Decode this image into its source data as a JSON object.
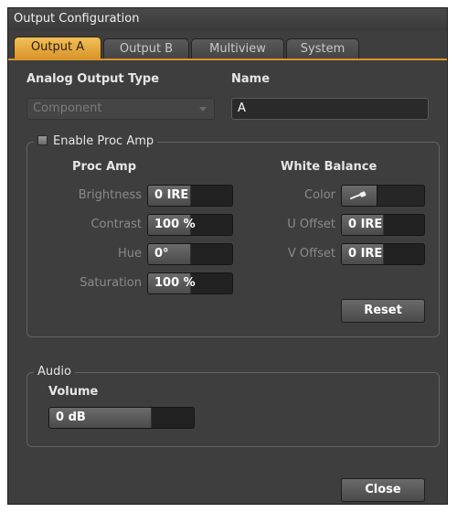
{
  "window": {
    "title": "Output Configuration"
  },
  "tabs": [
    {
      "label": "Output A",
      "active": true
    },
    {
      "label": "Output B",
      "active": false
    },
    {
      "label": "Multiview",
      "active": false
    },
    {
      "label": "System",
      "active": false
    }
  ],
  "output": {
    "analog_output_type_label": "Analog Output Type",
    "analog_output_type_value": "Component",
    "name_label": "Name",
    "name_value": "A"
  },
  "proc_amp": {
    "enable_label": "Enable Proc Amp",
    "section_title": "Proc Amp",
    "brightness": {
      "label": "Brightness",
      "value": "0 IRE",
      "level": 0.5
    },
    "contrast": {
      "label": "Contrast",
      "value": "100 %",
      "level": 0.5
    },
    "hue": {
      "label": "Hue",
      "value": "0°",
      "level": 0.5
    },
    "saturation": {
      "label": "Saturation",
      "value": "100 %",
      "level": 0.5
    }
  },
  "white_balance": {
    "section_title": "White Balance",
    "color_label": "Color",
    "color_icon": "eyedropper-icon",
    "u_offset": {
      "label": "U Offset",
      "value": "0 IRE",
      "level": 0.5
    },
    "v_offset": {
      "label": "V Offset",
      "value": "0 IRE",
      "level": 0.5
    },
    "reset_label": "Reset"
  },
  "audio": {
    "group_label": "Audio",
    "volume_label": "Volume",
    "volume_value": "0 dB",
    "volume_level": 0.7
  },
  "footer": {
    "close_label": "Close"
  },
  "colors": {
    "accent": "#d9952a",
    "panel": "#3e3e3e",
    "field": "#222222"
  }
}
